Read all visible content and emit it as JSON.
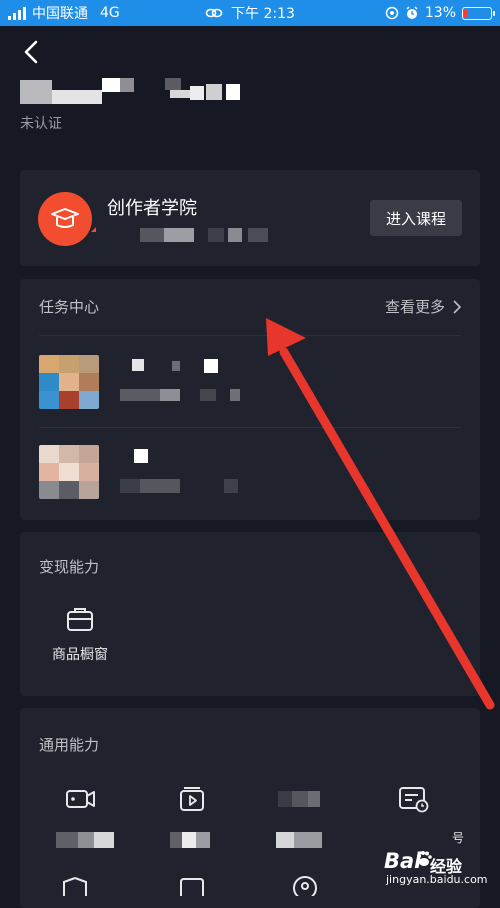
{
  "status_bar": {
    "carrier": "中国联通",
    "network": "4G",
    "time": "下午 2:13",
    "battery": "13%"
  },
  "profile": {
    "status": "未认证"
  },
  "academy": {
    "title": "创作者学院",
    "button_label": "进入课程"
  },
  "tasks": {
    "title": "任务中心",
    "see_more": "查看更多"
  },
  "monetize": {
    "title": "变现能力",
    "tools": [
      {
        "label": "商品橱窗",
        "icon": "briefcase-icon"
      }
    ]
  },
  "general": {
    "title": "通用能力",
    "icons": [
      "video-camera-icon",
      "video-play-icon",
      "masked-icon",
      "scheduled-post-icon"
    ]
  },
  "watermark": {
    "brand": "Bai",
    "brand_cn": "经验",
    "url": "jingyan.baidu.com",
    "partial": "号"
  },
  "colors": {
    "status_bar": "#1e8ee8",
    "background": "#161823",
    "card": "#20222d",
    "accent": "#f24d2e",
    "annotation_arrow": "#e8362c"
  }
}
